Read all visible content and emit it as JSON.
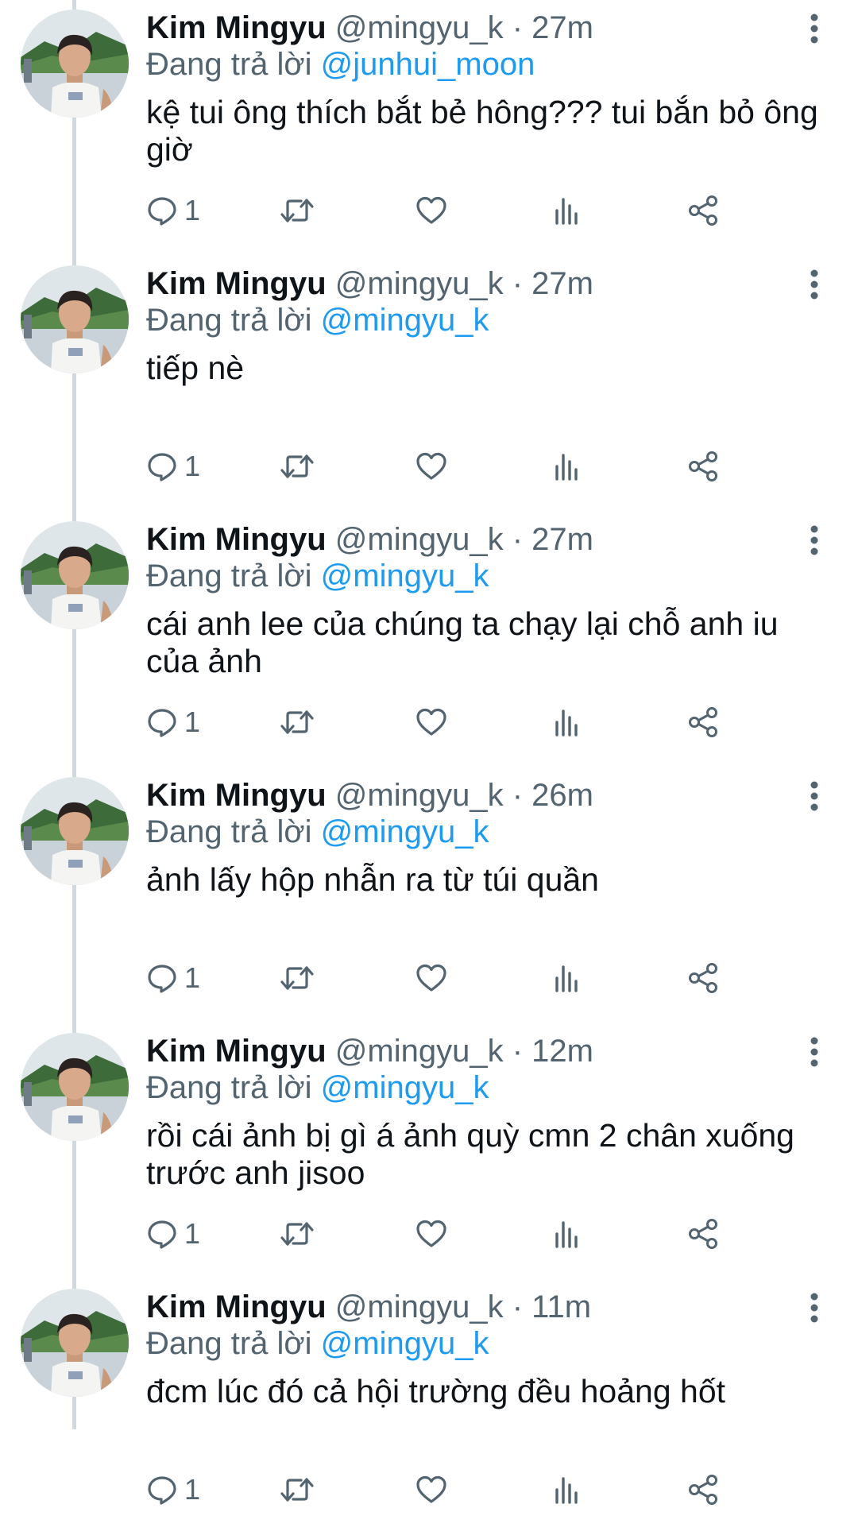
{
  "colors": {
    "accent": "#1d9bf0",
    "text": "#0f1419",
    "muted": "#536471",
    "thread_line": "#cfd9de"
  },
  "icons": {
    "reply": "reply-icon",
    "retweet": "retweet-icon",
    "like": "heart-icon",
    "views": "views-icon",
    "share": "share-icon",
    "more": "more-vertical-icon"
  },
  "tweets": [
    {
      "name": "Kim Mingyu",
      "handle": "@mingyu_k",
      "separator": "·",
      "time": "27m",
      "reply_prefix": "Đang trả lời",
      "reply_to": "@junhui_moon",
      "text": "kệ tui ông thích bắt bẻ hông??? tui bắn bỏ ông giờ",
      "reply_count": "1"
    },
    {
      "name": "Kim Mingyu",
      "handle": "@mingyu_k",
      "separator": "·",
      "time": "27m",
      "reply_prefix": "Đang trả lời",
      "reply_to": "@mingyu_k",
      "text": "tiếp nè",
      "reply_count": "1"
    },
    {
      "name": "Kim Mingyu",
      "handle": "@mingyu_k",
      "separator": "·",
      "time": "27m",
      "reply_prefix": "Đang trả lời",
      "reply_to": "@mingyu_k",
      "text": "cái anh lee của chúng ta chạy lại chỗ anh iu của ảnh",
      "reply_count": "1"
    },
    {
      "name": "Kim Mingyu",
      "handle": "@mingyu_k",
      "separator": "·",
      "time": "26m",
      "reply_prefix": "Đang trả lời",
      "reply_to": "@mingyu_k",
      "text": "ảnh lấy hộp nhẫn ra từ túi quần",
      "reply_count": "1"
    },
    {
      "name": "Kim Mingyu",
      "handle": "@mingyu_k",
      "separator": "·",
      "time": "12m",
      "reply_prefix": "Đang trả lời",
      "reply_to": "@mingyu_k",
      "text": "rồi cái ảnh bị gì á ảnh quỳ cmn 2 chân xuống trước anh jisoo",
      "reply_count": "1"
    },
    {
      "name": "Kim Mingyu",
      "handle": "@mingyu_k",
      "separator": "·",
      "time": "11m",
      "reply_prefix": "Đang trả lời",
      "reply_to": "@mingyu_k",
      "text": "đcm lúc đó cả hội trường đều hoảng hốt",
      "reply_count": "1"
    }
  ]
}
